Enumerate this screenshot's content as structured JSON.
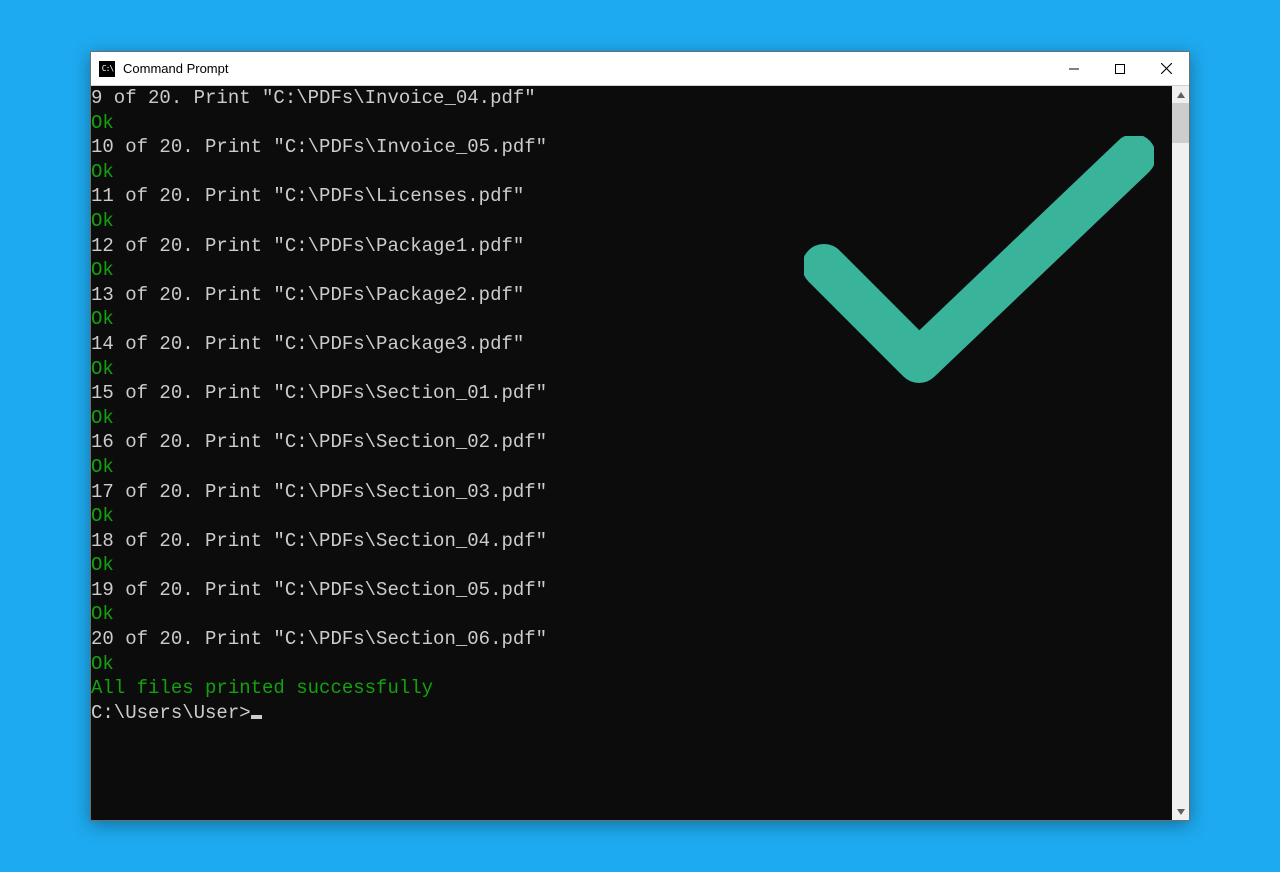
{
  "window": {
    "title": "Command Prompt",
    "icon_label": "cmd-icon"
  },
  "colors": {
    "ok": "#13a10e",
    "text": "#cccccc",
    "bg": "#0c0c0c",
    "check_overlay": "#39b39a",
    "desktop": "#1eaaf0"
  },
  "terminal": {
    "lines": [
      {
        "text": "9 of 20. Print \"C:\\PDFs\\Invoice_04.pdf\"",
        "cls": ""
      },
      {
        "text": "Ok",
        "cls": "ok"
      },
      {
        "text": "10 of 20. Print \"C:\\PDFs\\Invoice_05.pdf\"",
        "cls": ""
      },
      {
        "text": "Ok",
        "cls": "ok"
      },
      {
        "text": "11 of 20. Print \"C:\\PDFs\\Licenses.pdf\"",
        "cls": ""
      },
      {
        "text": "Ok",
        "cls": "ok"
      },
      {
        "text": "12 of 20. Print \"C:\\PDFs\\Package1.pdf\"",
        "cls": ""
      },
      {
        "text": "Ok",
        "cls": "ok"
      },
      {
        "text": "13 of 20. Print \"C:\\PDFs\\Package2.pdf\"",
        "cls": ""
      },
      {
        "text": "Ok",
        "cls": "ok"
      },
      {
        "text": "14 of 20. Print \"C:\\PDFs\\Package3.pdf\"",
        "cls": ""
      },
      {
        "text": "Ok",
        "cls": "ok"
      },
      {
        "text": "15 of 20. Print \"C:\\PDFs\\Section_01.pdf\"",
        "cls": ""
      },
      {
        "text": "Ok",
        "cls": "ok"
      },
      {
        "text": "16 of 20. Print \"C:\\PDFs\\Section_02.pdf\"",
        "cls": ""
      },
      {
        "text": "Ok",
        "cls": "ok"
      },
      {
        "text": "17 of 20. Print \"C:\\PDFs\\Section_03.pdf\"",
        "cls": ""
      },
      {
        "text": "Ok",
        "cls": "ok"
      },
      {
        "text": "18 of 20. Print \"C:\\PDFs\\Section_04.pdf\"",
        "cls": ""
      },
      {
        "text": "Ok",
        "cls": "ok"
      },
      {
        "text": "19 of 20. Print \"C:\\PDFs\\Section_05.pdf\"",
        "cls": ""
      },
      {
        "text": "Ok",
        "cls": "ok"
      },
      {
        "text": "20 of 20. Print \"C:\\PDFs\\Section_06.pdf\"",
        "cls": ""
      },
      {
        "text": "Ok",
        "cls": "ok"
      },
      {
        "text": "",
        "cls": ""
      },
      {
        "text": "All files printed successfully",
        "cls": "success"
      },
      {
        "text": "",
        "cls": ""
      },
      {
        "text": "",
        "cls": ""
      }
    ],
    "prompt": "C:\\Users\\User>"
  }
}
